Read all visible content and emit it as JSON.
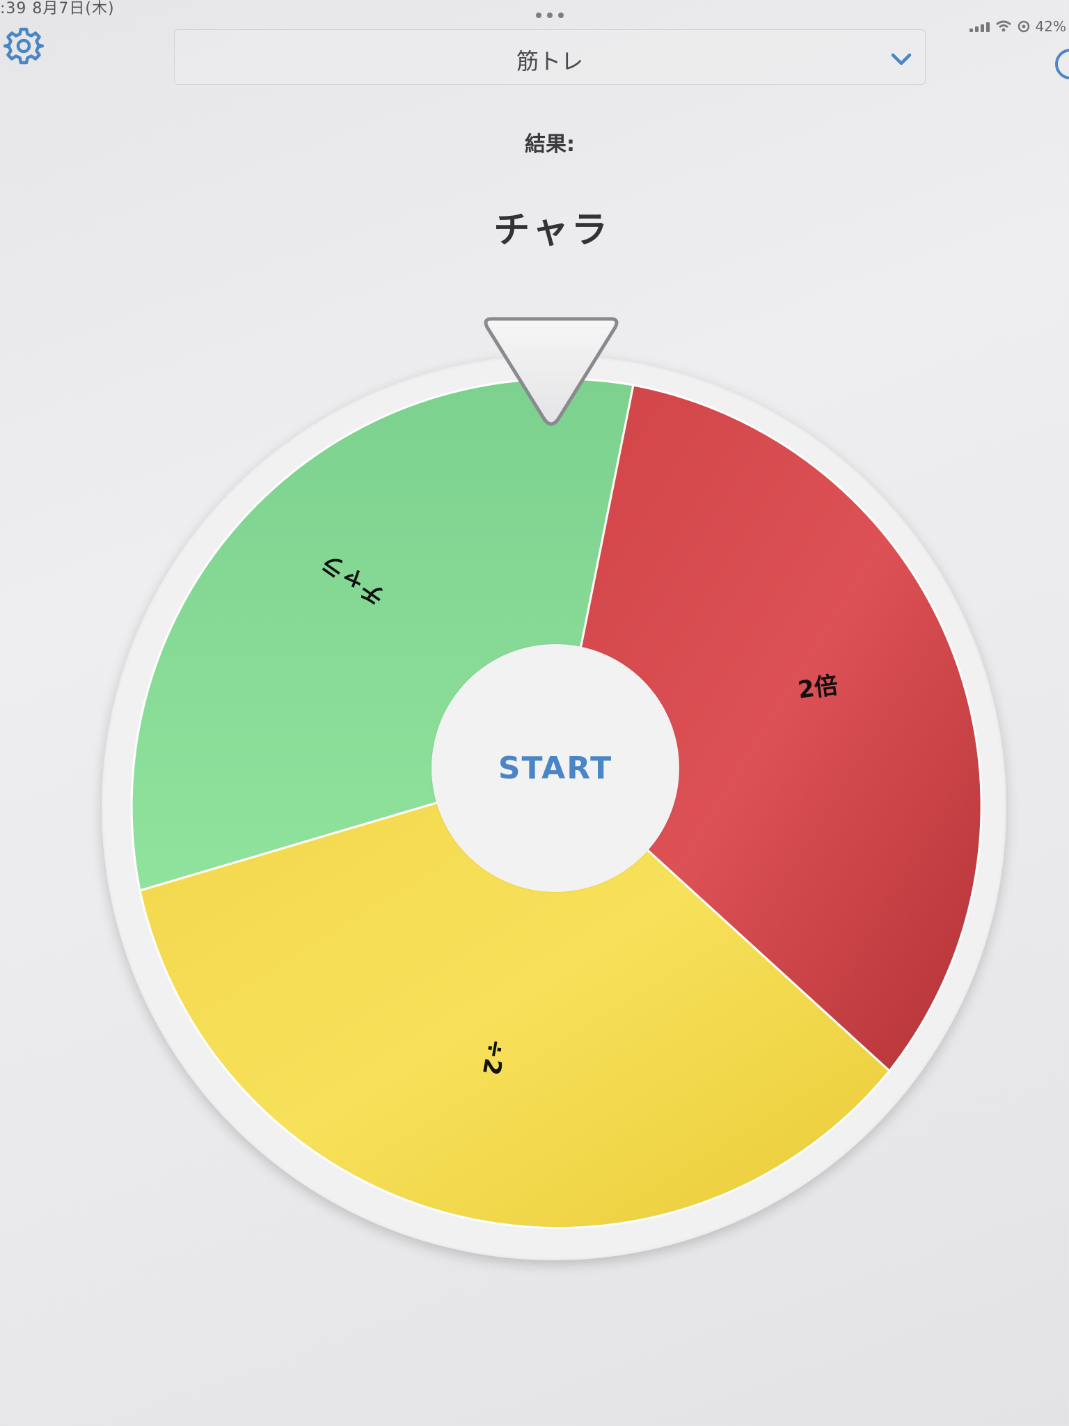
{
  "status_bar": {
    "time_date": ":39   8月7日(木)",
    "battery": "42%"
  },
  "toolbar": {
    "selector_value": "筋トレ",
    "settings_icon": "gear-icon",
    "selector_icon": "chevron-down-icon"
  },
  "result": {
    "heading": "結果:",
    "value": "チャラ"
  },
  "wheel": {
    "segments": [
      {
        "label": "チャラ",
        "color": "#86db94"
      },
      {
        "label": "2倍",
        "color": "#d8484b"
      },
      {
        "label": "÷2",
        "color": "#f5dc4c"
      }
    ],
    "start_label": "START",
    "accent_color": "#4a86c5"
  }
}
